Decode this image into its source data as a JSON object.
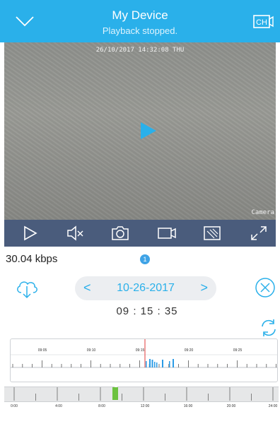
{
  "header": {
    "title": "My Device",
    "subtitle": "Playback stopped.",
    "channel_label": "CH"
  },
  "video": {
    "timestamp": "26/10/2017 14:32:08 THU",
    "camera_label": "Camera"
  },
  "controls": {
    "items": [
      {
        "name": "play-icon"
      },
      {
        "name": "mute-icon"
      },
      {
        "name": "snapshot-icon"
      },
      {
        "name": "record-icon"
      },
      {
        "name": "aspect-icon"
      },
      {
        "name": "fullscreen-icon"
      }
    ]
  },
  "status": {
    "bitrate": "30.04 kbps",
    "badge_count": "1"
  },
  "date_picker": {
    "date": "10-26-2017",
    "prev": "<",
    "next": ">"
  },
  "current_time": "09 : 15 : 35",
  "zoom_timeline": {
    "labels": [
      "09:05",
      "09:10",
      "09:15",
      "09:20",
      "09:25"
    ]
  },
  "day_timeline": {
    "labels": [
      "0:00",
      "4:00",
      "8:00",
      "12:00",
      "16:00",
      "20:00",
      "24:00"
    ]
  },
  "colors": {
    "accent": "#2ab0ea",
    "toolbar": "#4a5c7c",
    "recording": "#2a9be6",
    "day_recording": "#6cc23f",
    "cursor": "#e23b3b"
  }
}
